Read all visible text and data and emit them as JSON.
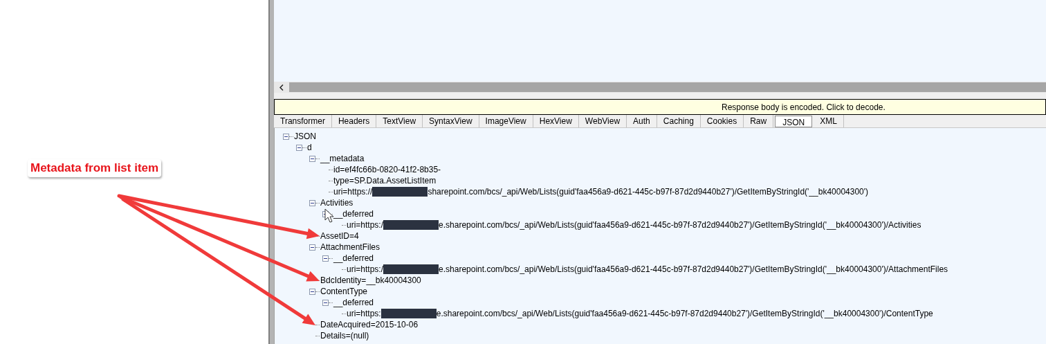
{
  "annotation": {
    "label": "Metadata from list item"
  },
  "notification": {
    "text": "Response body is encoded. Click to decode."
  },
  "tabs": [
    {
      "label": "Transformer",
      "selected": false
    },
    {
      "label": "Headers",
      "selected": false
    },
    {
      "label": "TextView",
      "selected": false
    },
    {
      "label": "SyntaxView",
      "selected": false
    },
    {
      "label": "ImageView",
      "selected": false
    },
    {
      "label": "HexView",
      "selected": false
    },
    {
      "label": "WebView",
      "selected": false
    },
    {
      "label": "Auth",
      "selected": false
    },
    {
      "label": "Caching",
      "selected": false
    },
    {
      "label": "Cookies",
      "selected": false
    },
    {
      "label": "Raw",
      "selected": false
    },
    {
      "label": "JSON",
      "selected": true
    },
    {
      "label": "XML",
      "selected": false
    }
  ],
  "tree": [
    {
      "parts": [
        "JSON"
      ],
      "expanded": true,
      "children": [
        {
          "parts": [
            "d"
          ],
          "expanded": true,
          "children": [
            {
              "parts": [
                "__metadata"
              ],
              "expanded": true,
              "children": [
                {
                  "parts": [
                    "id=ef4fc66b-0820-41f2-8b35-"
                  ]
                },
                {
                  "parts": [
                    "type=SP.Data.AssetListItem"
                  ]
                },
                {
                  "parts": [
                    "uri=https://",
                    "sharepoint.com/bcs/_api/Web/Lists(guid'faa456a9-d621-445c-b97f-87d2d9440b27')/GetItemByStringId('__bk40004300')"
                  ]
                }
              ]
            },
            {
              "parts": [
                "Activities"
              ],
              "expanded": true,
              "children": [
                {
                  "parts": [
                    "__deferred"
                  ],
                  "expanded": true,
                  "children": [
                    {
                      "parts": [
                        "uri=https:/",
                        "e.sharepoint.com/bcs/_api/Web/Lists(guid'faa456a9-d621-445c-b97f-87d2d9440b27')/GetItemByStringId('__bk40004300')/Activities"
                      ]
                    }
                  ]
                }
              ]
            },
            {
              "parts": [
                "AssetID=4"
              ]
            },
            {
              "parts": [
                "AttachmentFiles"
              ],
              "expanded": true,
              "children": [
                {
                  "parts": [
                    "__deferred"
                  ],
                  "expanded": true,
                  "children": [
                    {
                      "parts": [
                        "uri=https:/",
                        "e.sharepoint.com/bcs/_api/Web/Lists(guid'faa456a9-d621-445c-b97f-87d2d9440b27')/GetItemByStringId('__bk40004300')/AttachmentFiles"
                      ]
                    }
                  ]
                }
              ]
            },
            {
              "parts": [
                "BdcIdentity=__bk40004300"
              ]
            },
            {
              "parts": [
                "ContentType"
              ],
              "expanded": true,
              "children": [
                {
                  "parts": [
                    "__deferred"
                  ],
                  "expanded": true,
                  "children": [
                    {
                      "parts": [
                        "uri=https:",
                        "e.sharepoint.com/bcs/_api/Web/Lists(guid'faa456a9-d621-445c-b97f-87d2d9440b27')/GetItemByStringId('__bk40004300')/ContentType"
                      ]
                    }
                  ]
                }
              ]
            },
            {
              "parts": [
                "DateAcquired=2015-10-06"
              ]
            },
            {
              "parts": [
                "Details=(null)"
              ]
            }
          ]
        }
      ]
    }
  ]
}
